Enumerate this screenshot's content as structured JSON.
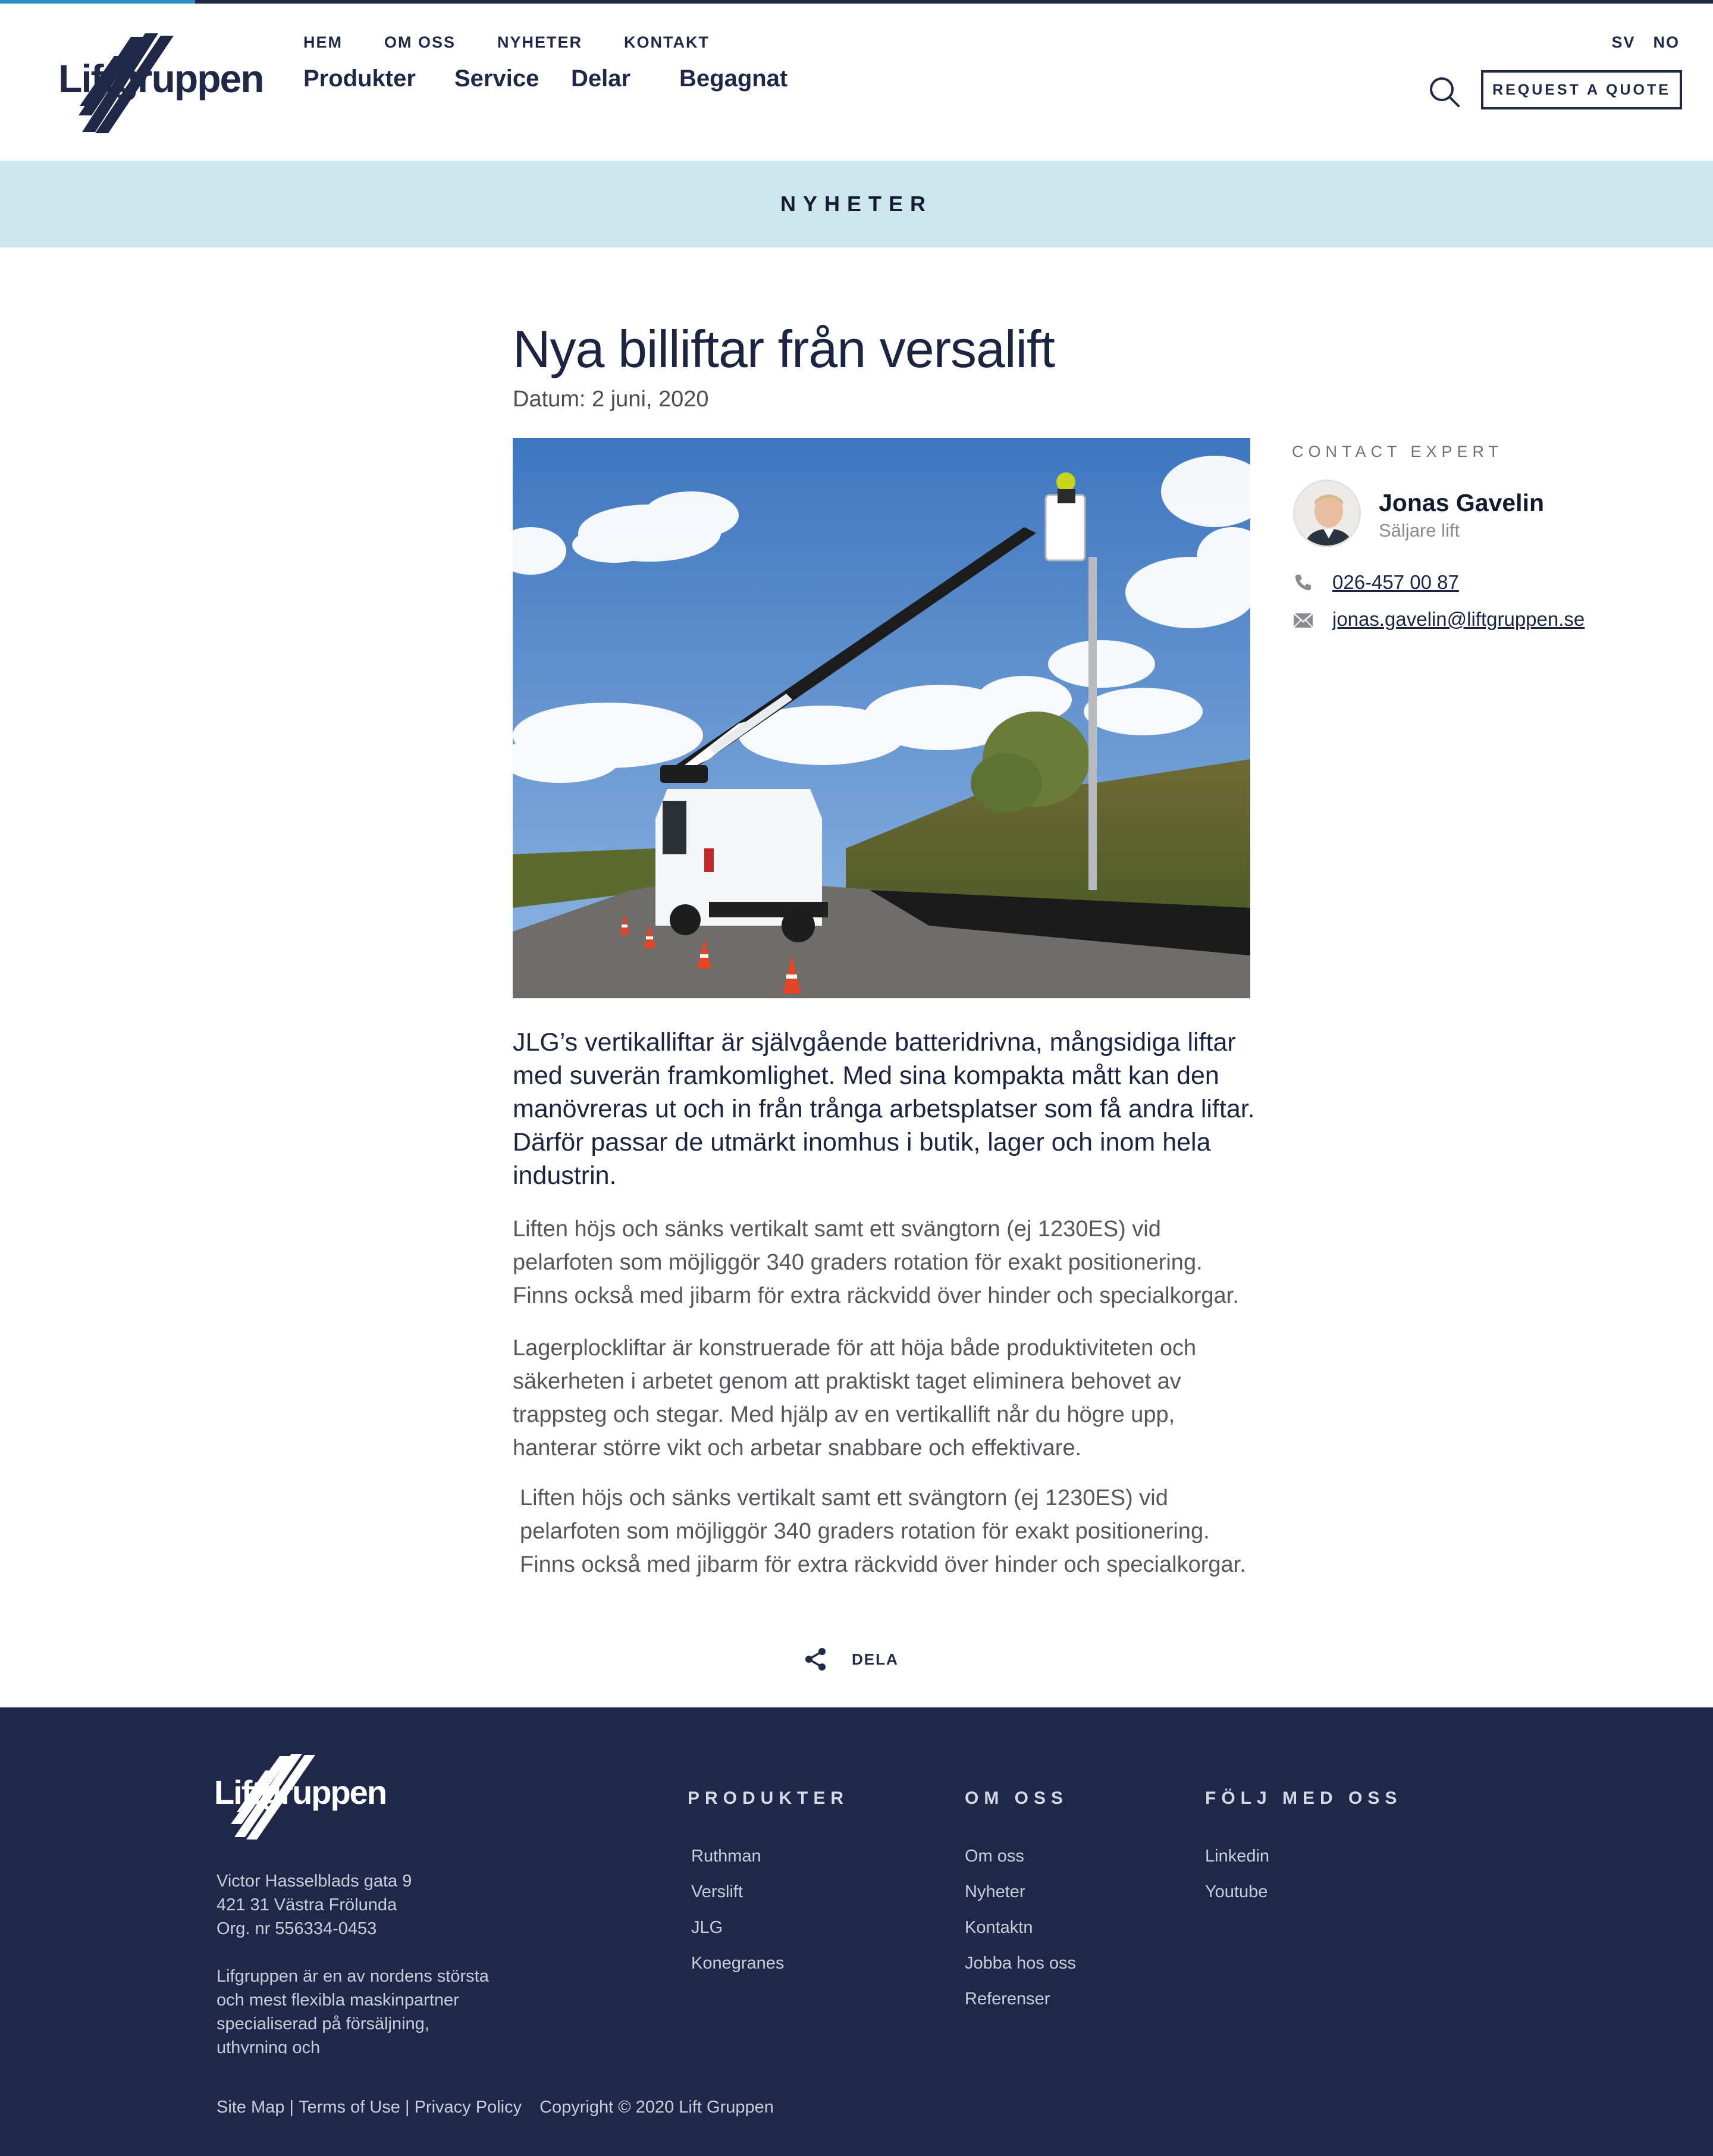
{
  "colors": {
    "navy": "#1f2847",
    "accent_blue": "#2a8fc4",
    "band_bg": "#cde6ee",
    "footer_bg": "#1f2848"
  },
  "header": {
    "logo_text": "Liftgruppen",
    "util_nav": [
      "HEM",
      "OM OSS",
      "NYHETER",
      "KONTAKT"
    ],
    "main_nav": [
      "Produkter",
      "Service",
      "Delar",
      "Begagnat"
    ],
    "languages": [
      "SV",
      "NO"
    ],
    "search_icon": "search-icon",
    "quote_button": "REQUEST A QUOTE"
  },
  "band": {
    "label": "NYHETER"
  },
  "article": {
    "title": "Nya billiftar från versalift",
    "date": "Datum: 2 juni, 2020",
    "lead": "JLG’s vertikalliftar är självgående batteridrivna, mångsidiga liftar med suverän framkomlighet. Med sina kompakta mått kan den manövreras ut och in från trånga arbetsplatser som få andra liftar. Därför passar de utmärkt inomhus i butik, lager och inom hela industrin.",
    "paragraph_1": "Liften höjs och sänks vertikalt samt ett svängtorn (ej 1230ES) vid pelarfoten som möjliggör 340 graders rotation för exakt positionering. Finns också med jibarm för extra räckvidd över hinder och specialkorgar.",
    "paragraph_2": "Lagerplockliftar är konstruerade för att höja både produktiviteten och säkerheten i arbetet genom att praktiskt taget eliminera behovet av trappsteg och stegar. Med hjälp av en vertikallift når du högre upp, hanterar större vikt och arbetar snabbare och effektivare.",
    "paragraph_3": "Liften höjs och sänks vertikalt samt ett svängtorn (ej 1230ES) vid pelarfoten som möjliggör 340 graders rotation för exakt positionering. Finns också med jibarm för extra räckvidd över hinder och specialkorgar."
  },
  "contact_expert": {
    "label": "CONTACT EXPERT",
    "name": "Jonas Gavelin",
    "role": "Säljare lift",
    "phone": "026-457 00 87",
    "email": "jonas.gavelin@liftgruppen.se"
  },
  "share": {
    "label": "DELA"
  },
  "footer": {
    "logo_text": "Liftgruppen",
    "address": [
      "Victor Hasselblads gata 9",
      "421 31 Västra Frölunda",
      "Org. nr 556334-0453"
    ],
    "about": "Lifgruppen  är en av nordens största och mest flexibla maskinpartner specialiserad på försäljning, uthyrning och",
    "produkter": {
      "heading": "PRODUKTER",
      "items": [
        "Ruthman",
        "Verslift",
        "JLG",
        "Konegranes"
      ]
    },
    "om_oss": {
      "heading": "OM OSS",
      "items": [
        "Om oss",
        "Nyheter",
        "Kontaktn",
        "Jobba hos oss",
        "Referenser"
      ]
    },
    "folj": {
      "heading": "FÖLJ MED OSS",
      "items": [
        "Linkedin",
        "Youtube"
      ]
    },
    "links": [
      "Site Map",
      "Terms of Use",
      "Privacy Policy"
    ],
    "separator": " | ",
    "copyright": "Copyright © 2020 Lift Gruppen"
  }
}
